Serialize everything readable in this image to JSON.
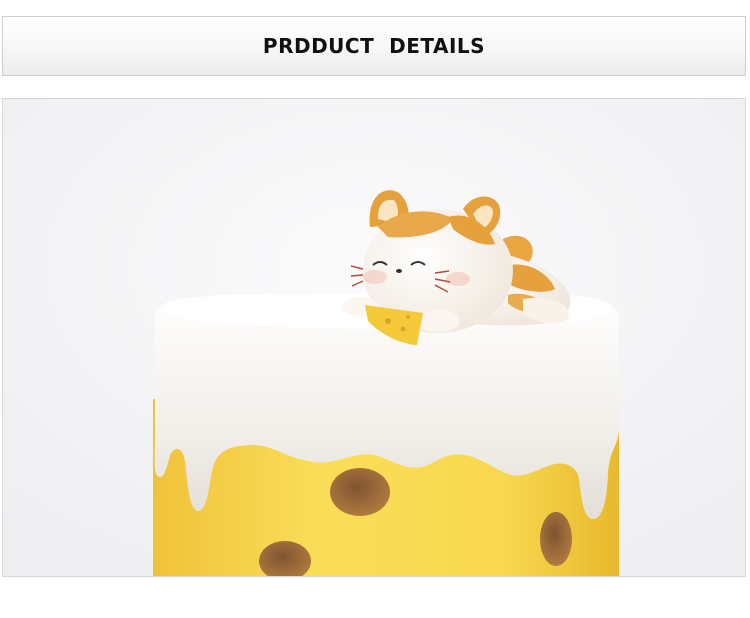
{
  "header": {
    "title": "PRDDUCT  DETAILS"
  },
  "product_photo": {
    "subject": "cat-on-cheese-candle",
    "colors": {
      "background": "#f5f5f7",
      "frosting": "#f4f1ec",
      "cheese": "#f7d54c",
      "cheese_shadow": "#e9b92a",
      "hole": "#9a6a3a",
      "cat_body": "#fbf4ea",
      "cat_orange": "#e6a03c"
    }
  }
}
